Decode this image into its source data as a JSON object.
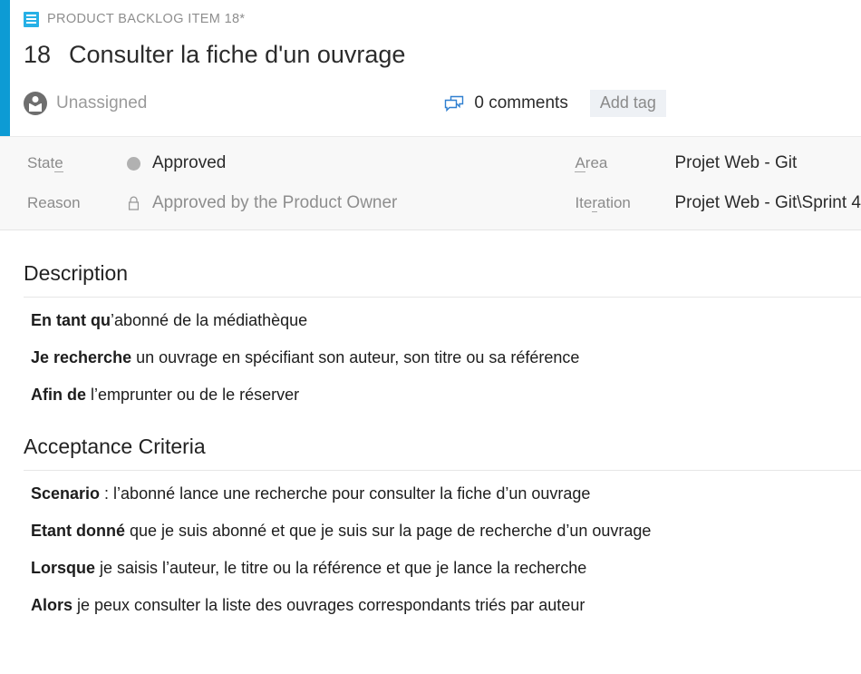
{
  "colors": {
    "accent_bar": "#0d9bd4",
    "type_icon": "#26b0e6",
    "comment_icon": "#2f7fd0",
    "state_dot": "#b1b1b1",
    "tag_button_bg": "#eef1f5"
  },
  "header": {
    "type_icon_name": "backlog-item-icon",
    "breadcrumb": "PRODUCT BACKLOG ITEM 18*",
    "work_item_id": "18",
    "title": "Consulter la fiche d'un ouvrage",
    "assignee": "Unassigned",
    "comments_label": "0 comments",
    "add_tag_label": "Add tag"
  },
  "fields": {
    "left": [
      {
        "label_prefix": "Stat",
        "label_underline": "e",
        "label_suffix": "",
        "value": "Approved",
        "indicator": "dot",
        "tone": "dark"
      },
      {
        "label_prefix": "Reason",
        "label_underline": "",
        "label_suffix": "",
        "value": "Approved by the Product Owner",
        "indicator": "lock",
        "tone": "muted"
      }
    ],
    "right": [
      {
        "label_prefix": "",
        "label_underline": "A",
        "label_suffix": "rea",
        "value": "Projet Web - Git",
        "indicator": "none",
        "tone": "dark"
      },
      {
        "label_prefix": "Ite",
        "label_underline": "r",
        "label_suffix": "ation",
        "value": "Projet Web - Git\\Sprint 4",
        "indicator": "none",
        "tone": "dark"
      }
    ]
  },
  "description": {
    "title": "Description",
    "lines": [
      {
        "bold": "En tant qu",
        "rest": "’abonné de la médiathèque"
      },
      {
        "bold": "Je recherche",
        "rest": " un ouvrage en spécifiant son auteur, son titre ou sa référence"
      },
      {
        "bold": "Afin de",
        "rest": " l’emprunter ou de le réserver"
      }
    ]
  },
  "acceptance": {
    "title": "Acceptance Criteria",
    "lines": [
      {
        "bold": "Scenario",
        "rest": " : l’abonné lance une recherche pour consulter la fiche d’un ouvrage"
      },
      {
        "bold": "Etant donné",
        "rest": " que je suis abonné et que je suis sur la page de recherche d’un ouvrage"
      },
      {
        "bold": "Lorsque",
        "rest": " je saisis l’auteur, le titre ou la référence et que je lance la recherche"
      },
      {
        "bold": "Alors",
        "rest": " je peux consulter la liste des ouvrages correspondants triés par auteur"
      }
    ]
  }
}
